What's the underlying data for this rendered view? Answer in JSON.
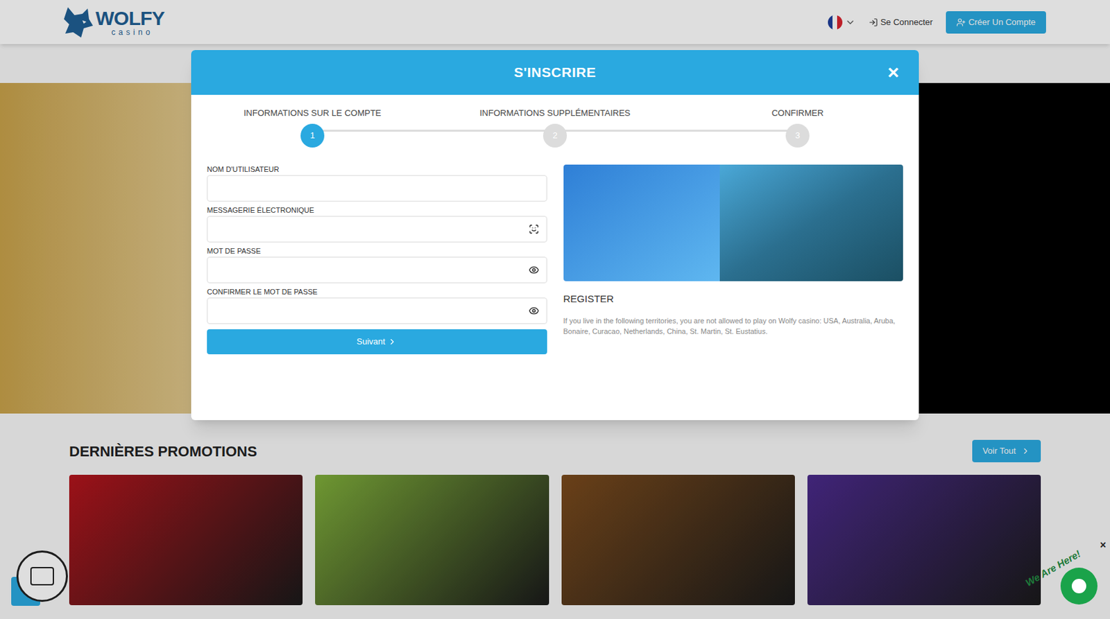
{
  "header": {
    "logo": {
      "title": "WOLFY",
      "subtitle": "casino"
    },
    "login": "Se Connecter",
    "signup": "Créer Un Compte"
  },
  "modal": {
    "title": "S'INSCRIRE",
    "close": "×",
    "steps": [
      {
        "label": "INFORMATIONS SUR LE COMPTE",
        "number": "1",
        "selected": true
      },
      {
        "label": "INFORMATIONS SUPPLÉMENTAIRES",
        "number": "2",
        "selected": false
      },
      {
        "label": "CONFIRMER",
        "number": "3",
        "selected": false
      }
    ],
    "fields": [
      {
        "label": "NOM D'UTILISATEUR",
        "kind": "text",
        "value": ""
      },
      {
        "label": "MESSAGERIE ÉLECTRONIQUE",
        "kind": "email",
        "value": ""
      },
      {
        "label": "MOT DE PASSE",
        "kind": "password",
        "value": ""
      },
      {
        "label": "CONFIRMER LE MOT DE PASSE",
        "kind": "password",
        "value": ""
      }
    ],
    "submit": "Suivant",
    "register": {
      "title": "REGISTER",
      "note": "If you live in the following territories, you are not allowed to play on Wolfy casino: USA, Australia, Aruba, Bonaire, Curacao, Netherlands, China, St. Martin, St. Eustatius."
    }
  },
  "promotions": {
    "title": "DERNIÈRES PROMOTIONS",
    "see_all": "Voir Tout",
    "cards": [
      {
        "color": "#b3141c"
      },
      {
        "color": "#7fae3a"
      },
      {
        "color": "#7a4a1c"
      },
      {
        "color": "#4a2a8a"
      }
    ]
  },
  "chat": {
    "label": "We Are Here!",
    "close": "×"
  }
}
